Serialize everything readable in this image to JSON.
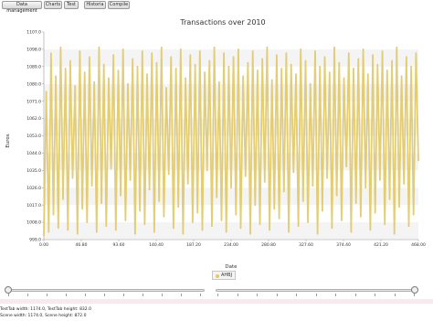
{
  "toolbar": {
    "tabs": [
      "Data management",
      "Charts",
      "Test",
      "Historia",
      "Compile"
    ]
  },
  "chart_data": {
    "type": "line",
    "title": "Transactions over 2010",
    "xlabel": "Date",
    "ylabel": "Euros",
    "xlim": [
      0,
      468
    ],
    "ylim": [
      999.0,
      1107.0
    ],
    "x_ticks": [
      "0.00",
      "46.80",
      "93.60",
      "140.40",
      "187.20",
      "234.00",
      "280.80",
      "327.60",
      "374.40",
      "421.20",
      "468.00"
    ],
    "y_ticks": [
      "999.0",
      "1008.0",
      "1017.0",
      "1026.0",
      "1035.0",
      "1044.0",
      "1053.0",
      "1062.0",
      "1071.0",
      "1080.0",
      "1089.0",
      "1098.0",
      "1107.0"
    ],
    "grid": "horizontal-bands",
    "legend_position": "bottom-center",
    "series": [
      {
        "name": "AHBJ",
        "color": "#e0c866",
        "x": [
          0,
          3,
          6,
          9,
          12,
          15,
          18,
          21,
          24,
          27,
          30,
          33,
          36,
          39,
          42,
          45,
          48,
          51,
          54,
          57,
          60,
          63,
          66,
          69,
          72,
          75,
          78,
          81,
          84,
          87,
          90,
          93,
          96,
          99,
          102,
          105,
          108,
          111,
          114,
          117,
          120,
          123,
          126,
          129,
          132,
          135,
          138,
          141,
          144,
          147,
          150,
          153,
          156,
          159,
          162,
          165,
          168,
          171,
          174,
          177,
          180,
          183,
          186,
          189,
          192,
          195,
          198,
          201,
          204,
          207,
          210,
          213,
          216,
          219,
          222,
          225,
          228,
          231,
          234,
          237,
          240,
          243,
          246,
          249,
          252,
          255,
          258,
          261,
          264,
          267,
          270,
          273,
          276,
          279,
          282,
          285,
          288,
          291,
          294,
          297,
          300,
          303,
          306,
          309,
          312,
          315,
          318,
          321,
          324,
          327,
          330,
          333,
          336,
          339,
          342,
          345,
          348,
          351,
          354,
          357,
          360,
          363,
          366,
          369,
          372,
          375,
          378,
          381,
          384,
          387,
          390,
          393,
          396,
          399,
          402,
          405,
          408,
          411,
          414,
          417,
          420,
          423,
          426,
          429,
          432,
          435,
          438,
          441,
          444,
          447,
          450,
          453,
          456,
          459,
          462,
          465,
          468
        ],
        "values": [
          1001,
          1076,
          1003,
          1096,
          1012,
          1084,
          1005,
          1099,
          1020,
          1088,
          1004,
          1092,
          1031,
          1079,
          1002,
          1097,
          1015,
          1086,
          1008,
          1094,
          1027,
          1081,
          1003,
          1099,
          1018,
          1090,
          1006,
          1083,
          1036,
          1095,
          1004,
          1087,
          1022,
          1098,
          1009,
          1080,
          1030,
          1093,
          1002,
          1089,
          1014,
          1097,
          1007,
          1085,
          1025,
          1096,
          1003,
          1091,
          1019,
          1099,
          1011,
          1078,
          1033,
          1094,
          1005,
          1088,
          1016,
          1098,
          1002,
          1083,
          1028,
          1095,
          1008,
          1090,
          1013,
          1097,
          1004,
          1086,
          1035,
          1092,
          1006,
          1099,
          1021,
          1081,
          1009,
          1096,
          1003,
          1089,
          1026,
          1094,
          1012,
          1098,
          1005,
          1084,
          1032,
          1091,
          1002,
          1097,
          1017,
          1087,
          1007,
          1093,
          1029,
          1099,
          1004,
          1082,
          1015,
          1095,
          1010,
          1088,
          1024,
          1096,
          1003,
          1090,
          1034,
          1085,
          1006,
          1098,
          1019,
          1092,
          1008,
          1080,
          1027,
          1097,
          1002,
          1089,
          1014,
          1094,
          1031,
          1086,
          1005,
          1099,
          1022,
          1091,
          1009,
          1083,
          1037,
          1096,
          1003,
          1088,
          1018,
          1093,
          1011,
          1098,
          1026,
          1085,
          1004,
          1095,
          1013,
          1090,
          1030,
          1097,
          1007,
          1087,
          1020,
          1092,
          1002,
          1099,
          1016,
          1084,
          1028,
          1094,
          1006,
          1089,
          1012,
          1096,
          1040
        ]
      }
    ]
  },
  "legend": {
    "label": "AHBJ"
  },
  "status": {
    "line1": "TestTab width: 1174.0, TestTab height: 832.0",
    "line2": "Scene width: 1174.0, Scene height: 872.0"
  }
}
